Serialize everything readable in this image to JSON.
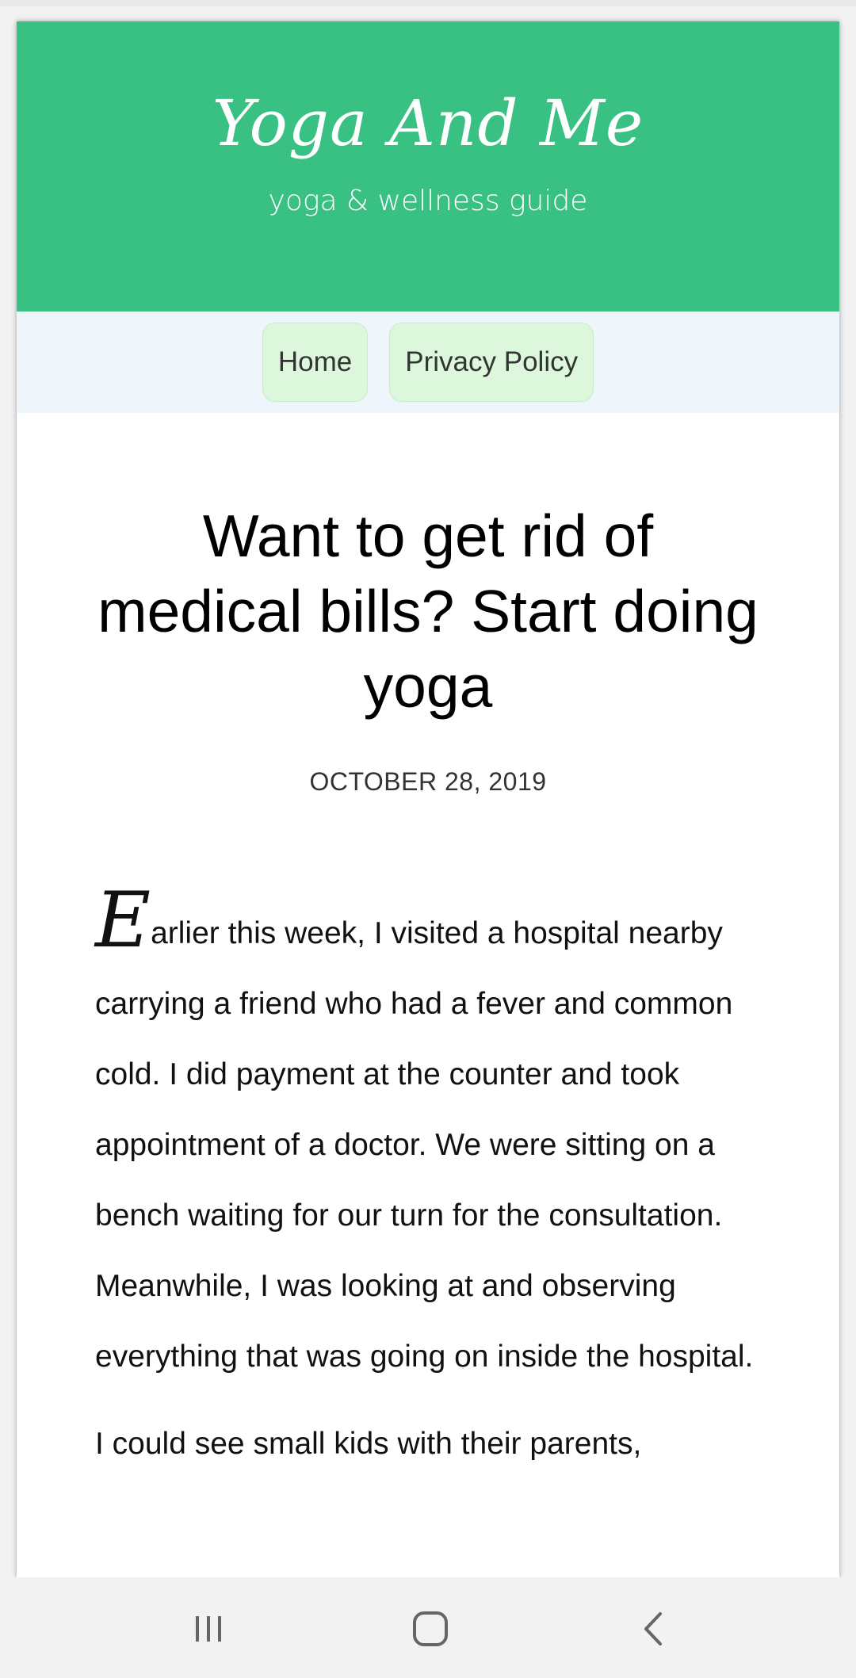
{
  "header": {
    "site_title": "Yoga And Me",
    "tagline": "yoga & wellness guide",
    "background_color": "#39c183"
  },
  "nav": {
    "items": [
      {
        "label": "Home"
      },
      {
        "label": "Privacy Policy"
      }
    ]
  },
  "post": {
    "title": "Want to get rid of medical bills? Start doing yoga",
    "date": "OCTOBER 28, 2019",
    "dropcap": "E",
    "paragraph1_rest": "arlier this week, I visited a hospital nearby carrying a friend who had a fever and common cold. I did payment at the counter and took appointment of a doctor. We were sitting on a bench waiting for our turn for the consultation. Meanwhile, I was looking at and observing everything that was going on inside the hospital.",
    "paragraph2": "I could see small kids with their parents,"
  },
  "system_nav": {
    "recents_icon": "recents-icon",
    "home_icon": "home-icon",
    "back_icon": "back-icon"
  }
}
